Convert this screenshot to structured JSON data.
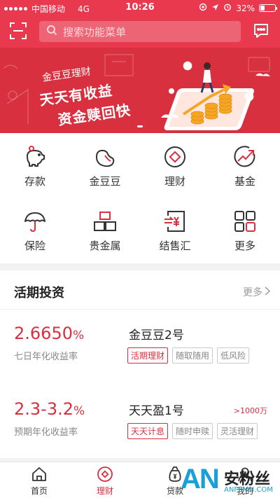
{
  "status_bar": {
    "carrier": "中国移动",
    "network": "4G",
    "time": "10:26",
    "battery": "32%"
  },
  "header": {
    "search_placeholder": "搜索功能菜单",
    "scan_icon": "scan-icon",
    "message_icon": "message-icon"
  },
  "banner": {
    "brand": "金豆豆理财",
    "line1": "天天有收益",
    "line2": "资金赎回快"
  },
  "menu": [
    {
      "label": "存款",
      "icon": "piggy-bank-icon"
    },
    {
      "label": "金豆豆",
      "icon": "bean-icon"
    },
    {
      "label": "理财",
      "icon": "coin-icon"
    },
    {
      "label": "基金",
      "icon": "trend-up-icon"
    },
    {
      "label": "保险",
      "icon": "umbrella-icon"
    },
    {
      "label": "贵金属",
      "icon": "gold-bars-icon"
    },
    {
      "label": "结售汇",
      "icon": "exchange-icon"
    },
    {
      "label": "更多",
      "icon": "grid-icon"
    }
  ],
  "section": {
    "title": "活期投资",
    "more": "更多"
  },
  "products": [
    {
      "rate": "2.6650",
      "unit": "%",
      "rate_label": "七日年化收益率",
      "name": "金豆豆2号",
      "min": "",
      "tags": [
        "活期理财",
        "随取随用",
        "低风险"
      ]
    },
    {
      "rate": "2.3-3.2",
      "unit": "%",
      "rate_label": "预期年化收益率",
      "name": "天天盈1号",
      "min": ">1000万",
      "tags": [
        "天天计息",
        "随时申赎",
        "灵活理财"
      ]
    }
  ],
  "tabs": [
    {
      "label": "首页",
      "icon": "home-icon"
    },
    {
      "label": "理财",
      "icon": "finance-icon"
    },
    {
      "label": "贷款",
      "icon": "loan-bag-icon"
    },
    {
      "label": "我的",
      "icon": "user-icon"
    }
  ],
  "watermark": {
    "an": "AN",
    "cn": "安粉丝",
    "url": "ANFENSI.COM"
  },
  "colors": {
    "brand_red": "#e8394f",
    "accent_red": "#d8303f"
  }
}
